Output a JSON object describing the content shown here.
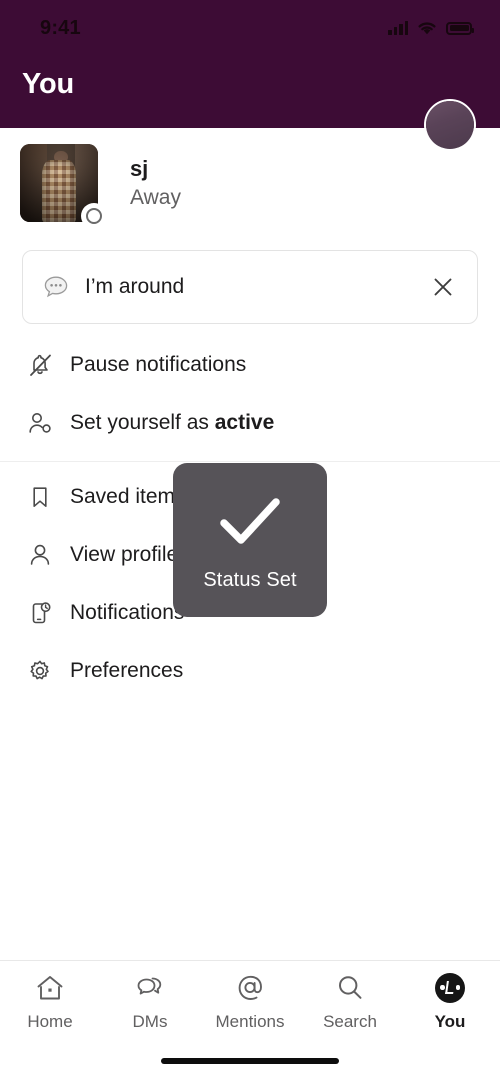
{
  "status_bar": {
    "time": "9:41",
    "signal_icon": "cellular-signal-icon",
    "wifi_icon": "wifi-icon",
    "battery_icon": "battery-full-icon"
  },
  "header": {
    "title": "You",
    "background_color": "#3D0C35",
    "avatar_name": "header-profile-avatar"
  },
  "profile": {
    "name": "sj",
    "presence": "Away",
    "presence_badge_icon": "away-circle-icon",
    "avatar_alt": "user-avatar-photo"
  },
  "status_field": {
    "emoji_icon": "speech-balloon-icon",
    "value": "I’m around",
    "clear_icon": "close-icon"
  },
  "menu": {
    "group_one": [
      {
        "icon": "bell-slash-icon",
        "label": "Pause notifications",
        "bold_suffix": ""
      },
      {
        "icon": "person-toggle-icon",
        "label": "Set yourself as ",
        "bold_suffix": "active"
      }
    ],
    "group_two": [
      {
        "icon": "bookmark-icon",
        "label": "Saved items"
      },
      {
        "icon": "person-icon",
        "label": "View profile"
      },
      {
        "icon": "mobile-bell-icon",
        "label": "Notifications"
      },
      {
        "icon": "gear-icon",
        "label": "Preferences"
      }
    ]
  },
  "toast": {
    "icon": "checkmark-icon",
    "label": "Status Set",
    "background_color": "#565358"
  },
  "tabbar": {
    "items": [
      {
        "icon": "home-icon",
        "label": "Home",
        "active": false
      },
      {
        "icon": "dms-icon",
        "label": "DMs",
        "active": false
      },
      {
        "icon": "at-mention-icon",
        "label": "Mentions",
        "active": false
      },
      {
        "icon": "search-icon",
        "label": "Search",
        "active": false
      },
      {
        "icon": "you-avatar-icon",
        "label": "You",
        "active": true
      }
    ]
  }
}
